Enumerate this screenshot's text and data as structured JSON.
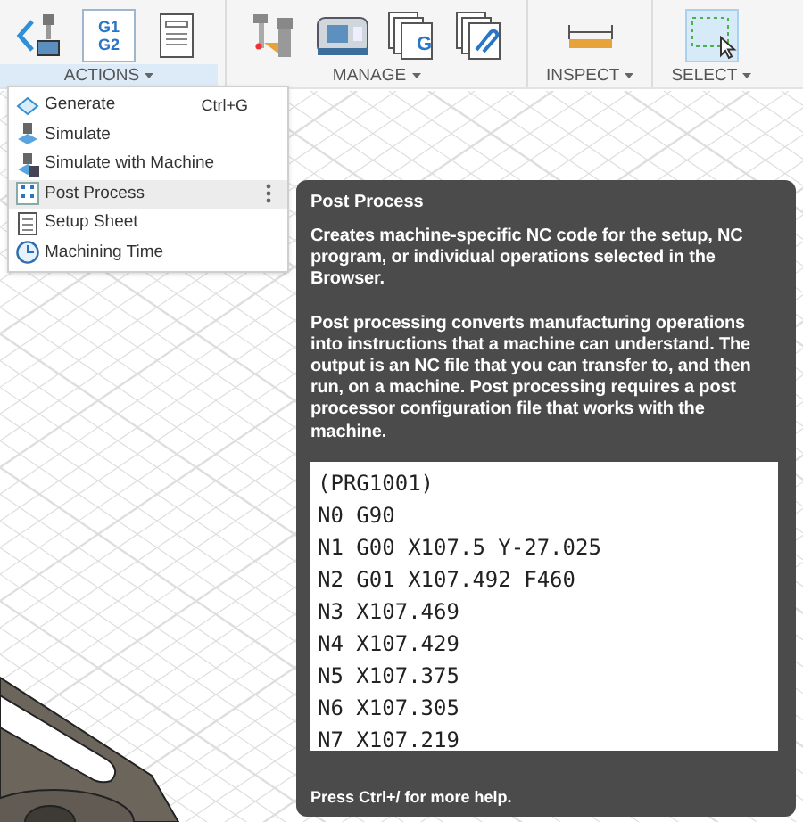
{
  "toolbar": {
    "groups": [
      {
        "label": "ACTIONS",
        "open": true,
        "tools": [
          {
            "kind": "generate"
          },
          {
            "kind": "nc-code",
            "glyphs": [
              "G1",
              "G2"
            ]
          },
          {
            "kind": "sheet"
          }
        ]
      },
      {
        "label": "MANAGE",
        "open": false,
        "tools": [
          {
            "kind": "tool-library"
          },
          {
            "kind": "machine"
          },
          {
            "kind": "pages",
            "glyphs": [
              "G"
            ]
          },
          {
            "kind": "pages-link"
          }
        ]
      },
      {
        "label": "INSPECT",
        "open": false,
        "tools": [
          {
            "kind": "ruler"
          }
        ]
      },
      {
        "label": "SELECT",
        "open": false,
        "tools": [
          {
            "kind": "select-box",
            "active": true
          }
        ]
      }
    ]
  },
  "menu": {
    "items": [
      {
        "kind": "generate",
        "label": "Generate",
        "shortcut": "Ctrl+G",
        "selected": false
      },
      {
        "kind": "simulate",
        "label": "Simulate",
        "selected": false
      },
      {
        "kind": "simulate-machine",
        "label": "Simulate with Machine",
        "selected": false
      },
      {
        "kind": "post",
        "label": "Post Process",
        "selected": true
      },
      {
        "kind": "sheet",
        "label": "Setup Sheet",
        "selected": false
      },
      {
        "kind": "clock",
        "label": "Machining Time",
        "selected": false
      }
    ]
  },
  "tooltip": {
    "title": "Post Process",
    "paragraphs": [
      "Creates machine-specific NC code for the setup, NC program, or individual operations selected in the Browser.",
      "Post processing converts manufacturing operations into instructions that a machine can understand. The output is an NC file that you can transfer to, and then run, on a machine. Post processing requires a post processor configuration file that works with the machine."
    ],
    "code_lines": [
      "(PRG1001)",
      "N0 G90",
      "N1 G00 X107.5 Y-27.025",
      "N2 G01 X107.492 F460",
      "N3 X107.469",
      "N4 X107.429",
      "N5 X107.375",
      "N6 X107.305",
      "N7 X107.219"
    ],
    "footer": "Press Ctrl+/ for more help."
  }
}
